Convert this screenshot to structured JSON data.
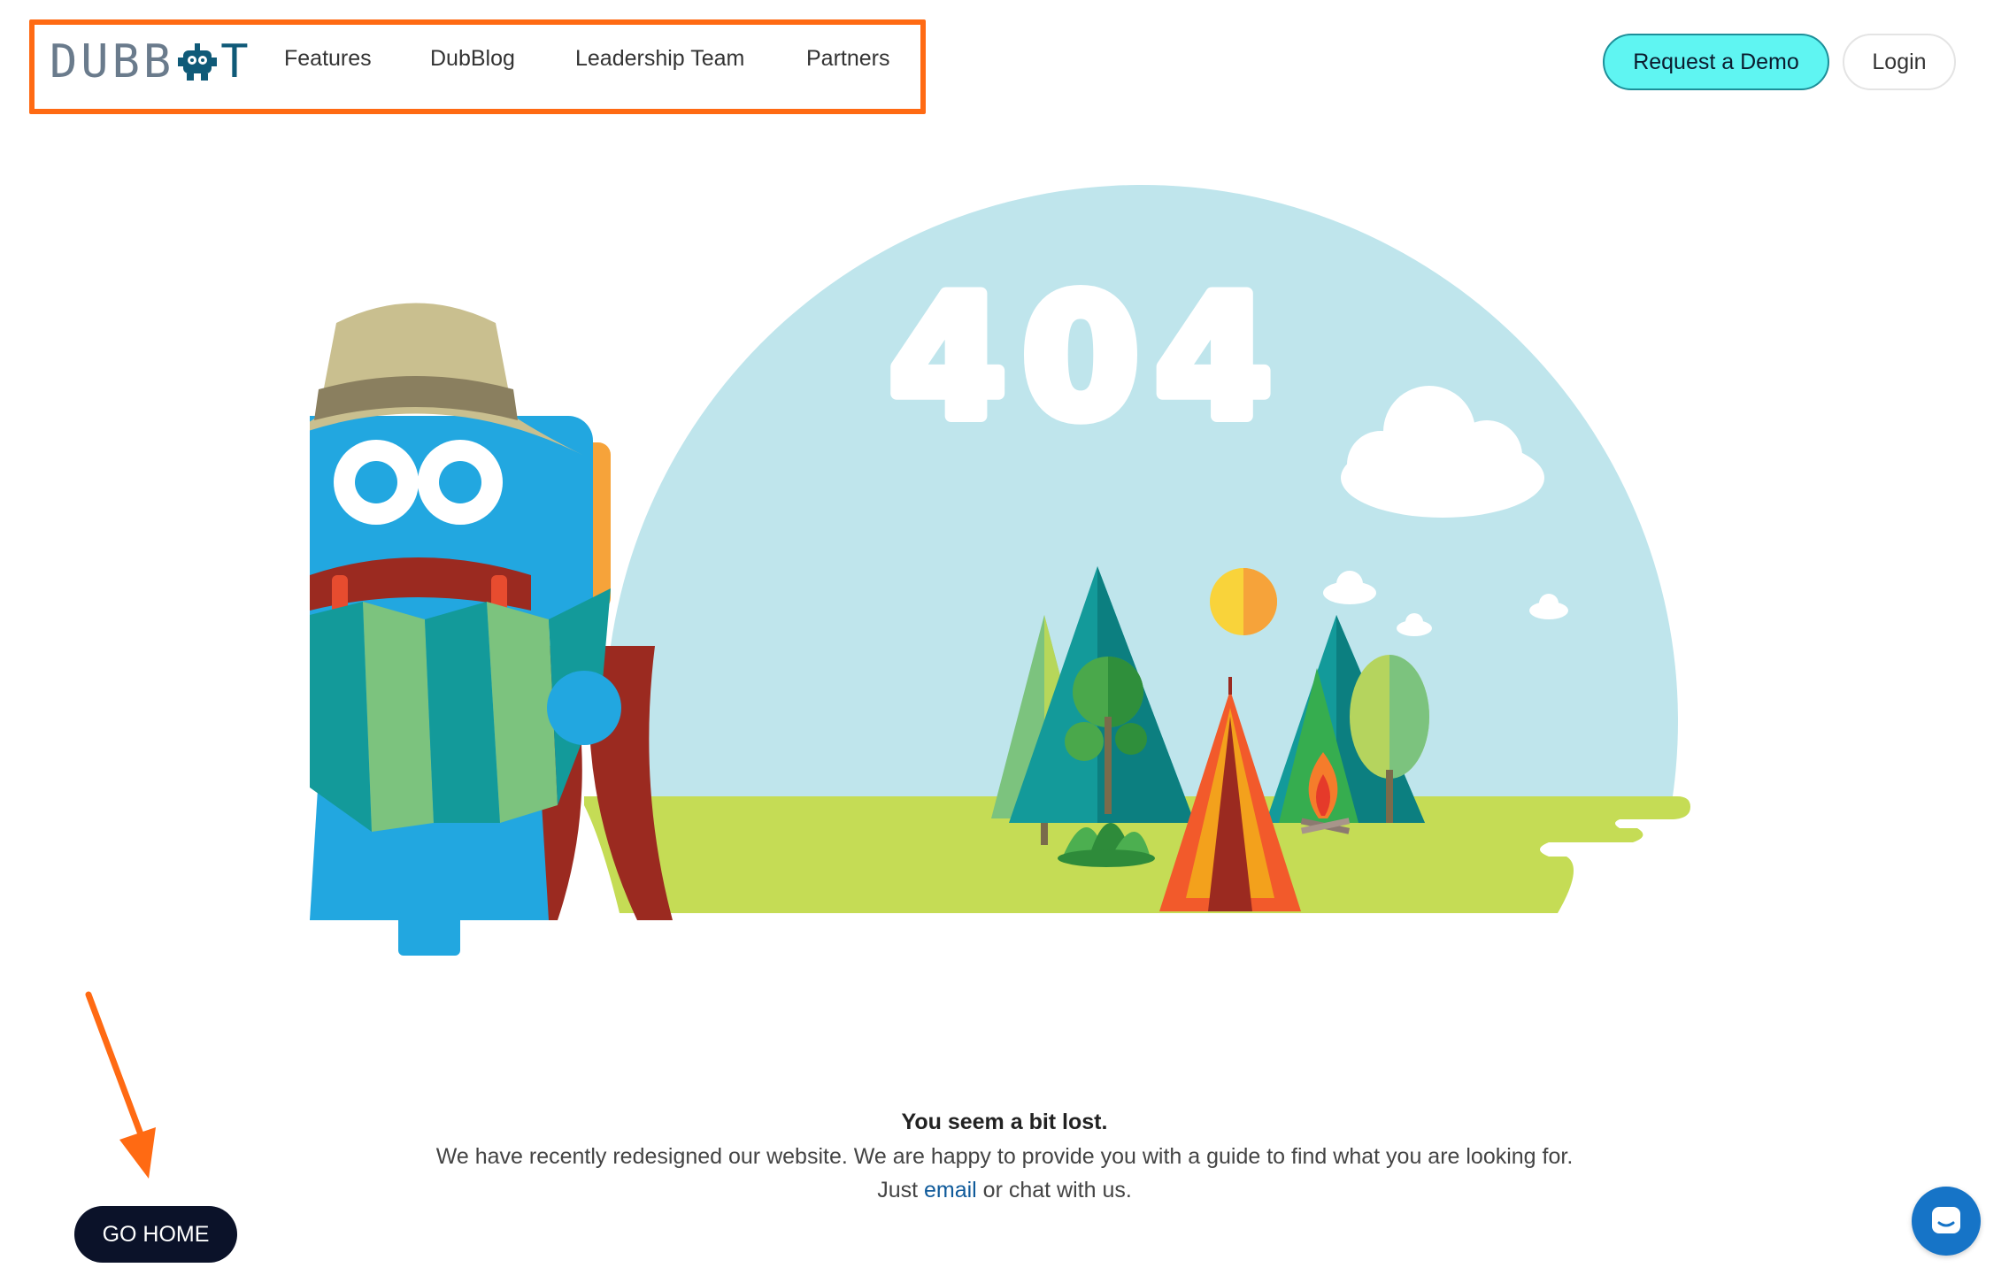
{
  "header": {
    "logo_left": "DUBB",
    "logo_right": "T",
    "nav": [
      {
        "label": "Features"
      },
      {
        "label": "DubBlog"
      },
      {
        "label": "Leadership Team"
      },
      {
        "label": "Partners"
      }
    ],
    "request_demo_label": "Request a Demo",
    "login_label": "Login"
  },
  "illustration": {
    "sky_text": "404"
  },
  "message": {
    "title": "You seem a bit lost.",
    "line1": "We have recently redesigned our website. We are happy to provide you with a guide to find what you are looking for.",
    "line2_prefix": "Just ",
    "line2_link": "email",
    "line2_suffix": " or chat with us."
  },
  "go_home_label": "GO HOME",
  "colors": {
    "highlight": "#ff6a13",
    "demo_button": "#5ff5f2",
    "home_button": "#0b1229",
    "chat": "#1674c7",
    "sky": "#bfe5ec",
    "robot": "#22a7e0"
  },
  "icons": {
    "chat": "chat-bubble-icon",
    "arrow": "arrow-down-icon"
  }
}
